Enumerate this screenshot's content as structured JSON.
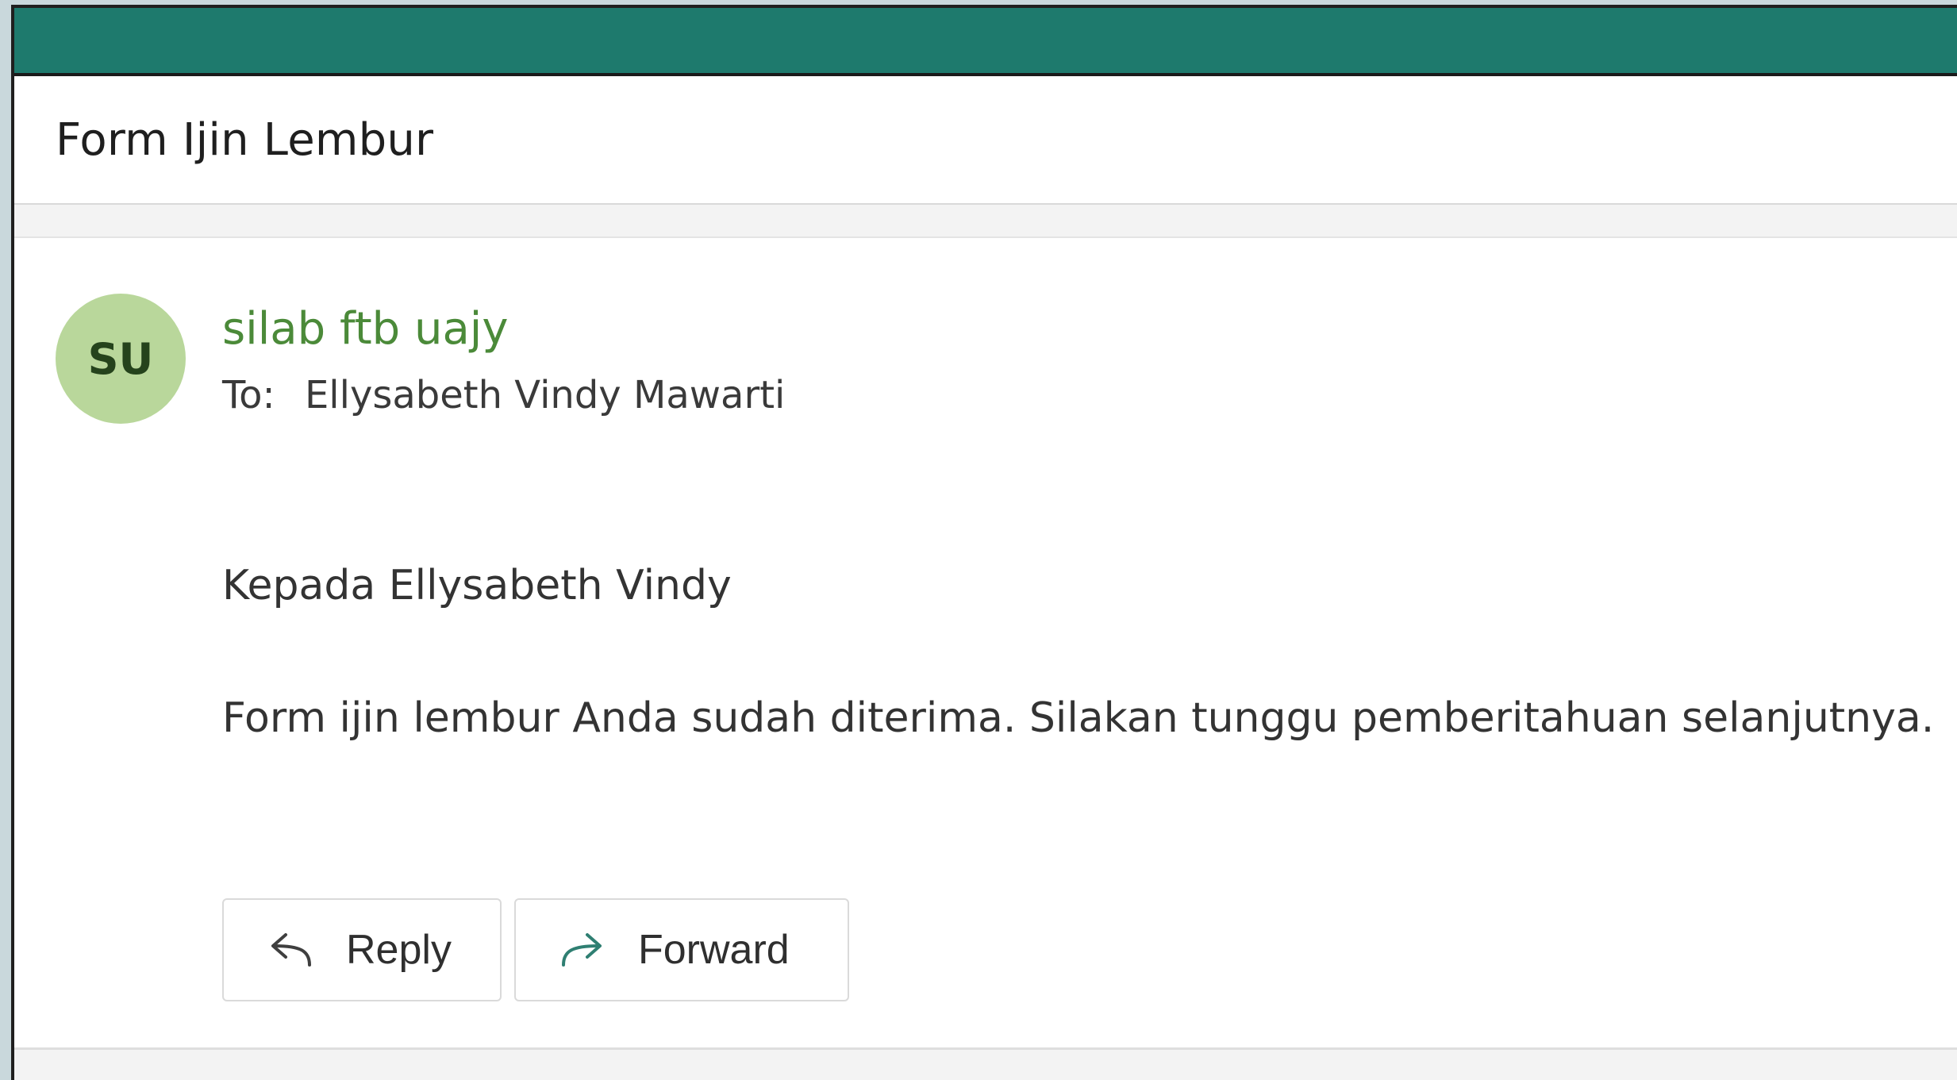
{
  "subject": "Form Ijin Lembur",
  "sender": {
    "initials": "SU",
    "name": "silab ftb uajy",
    "to_label": "To:",
    "to_name": "Ellysabeth Vindy Mawarti"
  },
  "body": {
    "greeting": "Kepada Ellysabeth Vindy",
    "paragraph": "Form ijin lembur Anda sudah diterima. Silakan tunggu pemberitahuan selanjutnya."
  },
  "actions": {
    "reply_label": "Reply",
    "reply_icon": "reply-arrow-icon",
    "forward_label": "Forward",
    "forward_icon": "forward-arrow-icon"
  },
  "colors": {
    "titlebar": "#1e7a6d",
    "avatar_bg": "#b9d79b",
    "sender_name": "#4b8a39",
    "forward_icon": "#2f7f72"
  }
}
